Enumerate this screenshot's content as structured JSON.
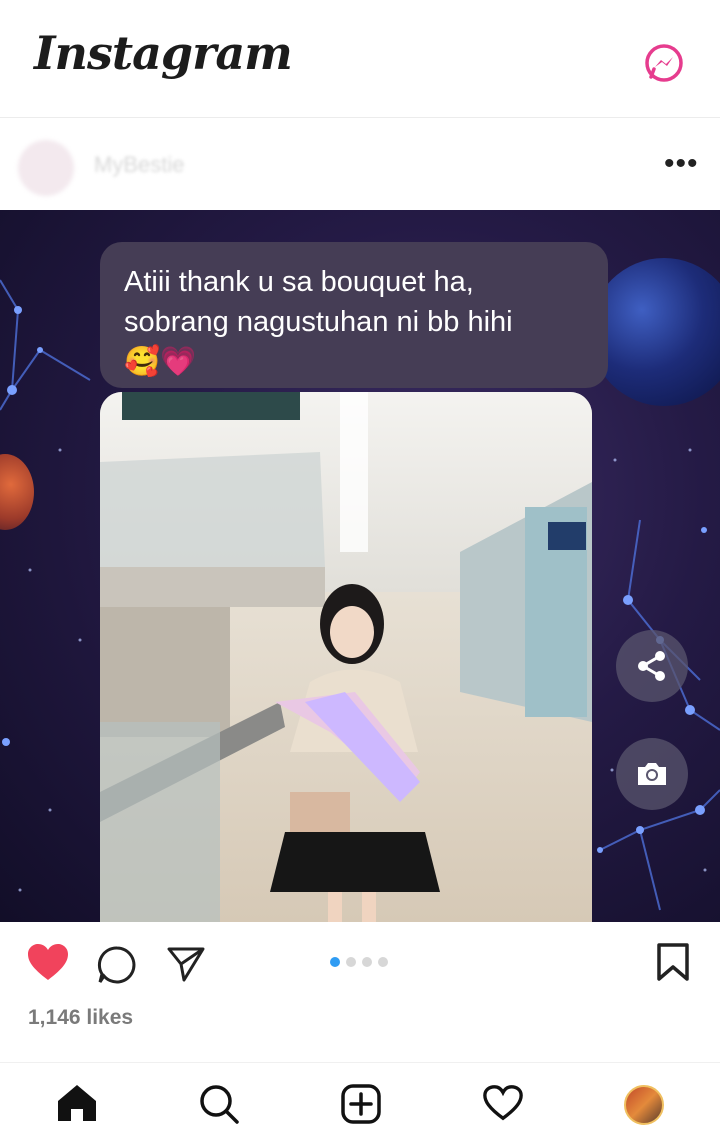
{
  "header": {
    "logo_text": "Instagram",
    "messenger_icon": "messenger-icon"
  },
  "post": {
    "username": "MyBestie",
    "more_icon": "more-horizontal-icon",
    "caption_bubble": {
      "line1": "Atiii thank u sa bouquet ha,",
      "line2": "sobrang nagustuhan ni bb hihi",
      "emoji": "🥰💗"
    },
    "overlay_buttons": {
      "share_icon": "share-icon",
      "camera_icon": "camera-icon"
    },
    "carousel": {
      "total": 4,
      "active_index": 0
    },
    "likes_text": "1,146 likes",
    "liked": true
  },
  "actions": {
    "like_icon": "heart-filled-icon",
    "comment_icon": "comment-icon",
    "send_icon": "send-icon",
    "save_icon": "bookmark-icon"
  },
  "bottom_nav": [
    "home-icon",
    "search-icon",
    "add-post-icon",
    "activity-heart-icon",
    "profile-avatar"
  ],
  "colors": {
    "like_red": "#f1435c",
    "accent_blue": "#2f9cf3",
    "messenger_pink": "#e63c8e",
    "bubble_bg": "#453d55",
    "space_bg": "#241a45"
  }
}
